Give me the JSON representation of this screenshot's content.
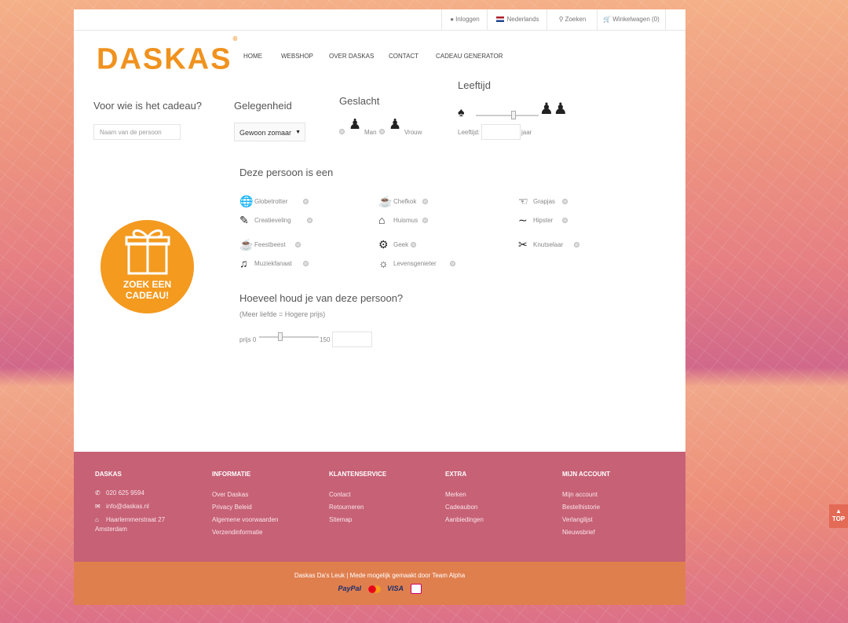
{
  "topbar": {
    "login": "Inloggen",
    "language": "Nederlands",
    "search": "Zoeken",
    "cart": "Winkelwagen (0)"
  },
  "logo": "DASKAS",
  "logo_mark": "®",
  "nav": [
    "HOME",
    "WEBSHOP",
    "OVER DASKAS",
    "CONTACT",
    "CADEAU GENERATOR"
  ],
  "form": {
    "who_heading": "Voor wie is het cadeau?",
    "name_placeholder": "Naam van de persoon",
    "occasion_heading": "Gelegenheid",
    "occasion_value": "Gewoon zomaar",
    "gender_heading": "Geslacht",
    "gender_man": "Man",
    "gender_woman": "Vrouw",
    "age_heading": "Leeftijd",
    "age_label": "Leeftijd:",
    "age_unit": "jaar",
    "age_slider_fraction": 0.6
  },
  "persona": {
    "heading": "Deze persoon is een",
    "items": [
      {
        "label": "Globetrotter",
        "icon": "globe-icon"
      },
      {
        "label": "Chefkok",
        "icon": "chef-hat-icon"
      },
      {
        "label": "Grapjas",
        "icon": "joker-icon"
      },
      {
        "label": "Creatieveling",
        "icon": "paintbrush-icon"
      },
      {
        "label": "Huismus",
        "icon": "house-icon"
      },
      {
        "label": "Hipster",
        "icon": "mustache-icon"
      },
      {
        "label": "Feestbeest",
        "icon": "champagne-icon"
      },
      {
        "label": "Geek",
        "icon": "robot-icon"
      },
      {
        "label": "Knutselaar",
        "icon": "scissors-icon"
      },
      {
        "label": "Muziekfanaat",
        "icon": "music-icon"
      },
      {
        "label": "Levensgenieter",
        "icon": "sunbed-icon"
      }
    ]
  },
  "budget": {
    "heading": "Hoeveel houd je van deze persoon?",
    "subheading": "(Meer liefde = Hogere prijs)",
    "min_label": "prijs 0",
    "max_label": "150",
    "slider_fraction": 0.35
  },
  "badge": {
    "line1": "ZOEK EEN",
    "line2": "CADEAU!"
  },
  "footer": {
    "cols": [
      {
        "heading": "DASKAS",
        "contacts": [
          {
            "icon": "phone-icon",
            "text": "020 625 9594"
          },
          {
            "icon": "envelope-icon",
            "text": "info@daskas.nl"
          },
          {
            "icon": "home-icon",
            "text": "Haarlemmerstraat 27",
            "text2": "Amsterdam"
          }
        ]
      },
      {
        "heading": "INFORMATIE",
        "links": [
          "Over Daskas",
          "Privacy Beleid",
          "Algemene voorwaarden",
          "Verzendinformatie"
        ]
      },
      {
        "heading": "KLANTENSERVICE",
        "links": [
          "Contact",
          "Retourneren",
          "Sitemap"
        ]
      },
      {
        "heading": "EXTRA",
        "links": [
          "Merken",
          "Cadeaubon",
          "Aanbiedingen"
        ]
      },
      {
        "heading": "MIJN ACCOUNT",
        "links": [
          "Mijn account",
          "Bestelhistorie",
          "Verlanglijst",
          "Nieuwsbrief"
        ]
      }
    ],
    "copyright": "Daskas Da's Leuk  |  Mede mogelijk gemaakt door Team Alpha",
    "payments": [
      "PayPal",
      "MasterCard",
      "VISA",
      "iDEAL"
    ]
  },
  "totop": "TOP",
  "colors": {
    "brand_orange": "#f0921e",
    "footer_pink": "#c66176",
    "footer_orange": "#e07f4e"
  }
}
